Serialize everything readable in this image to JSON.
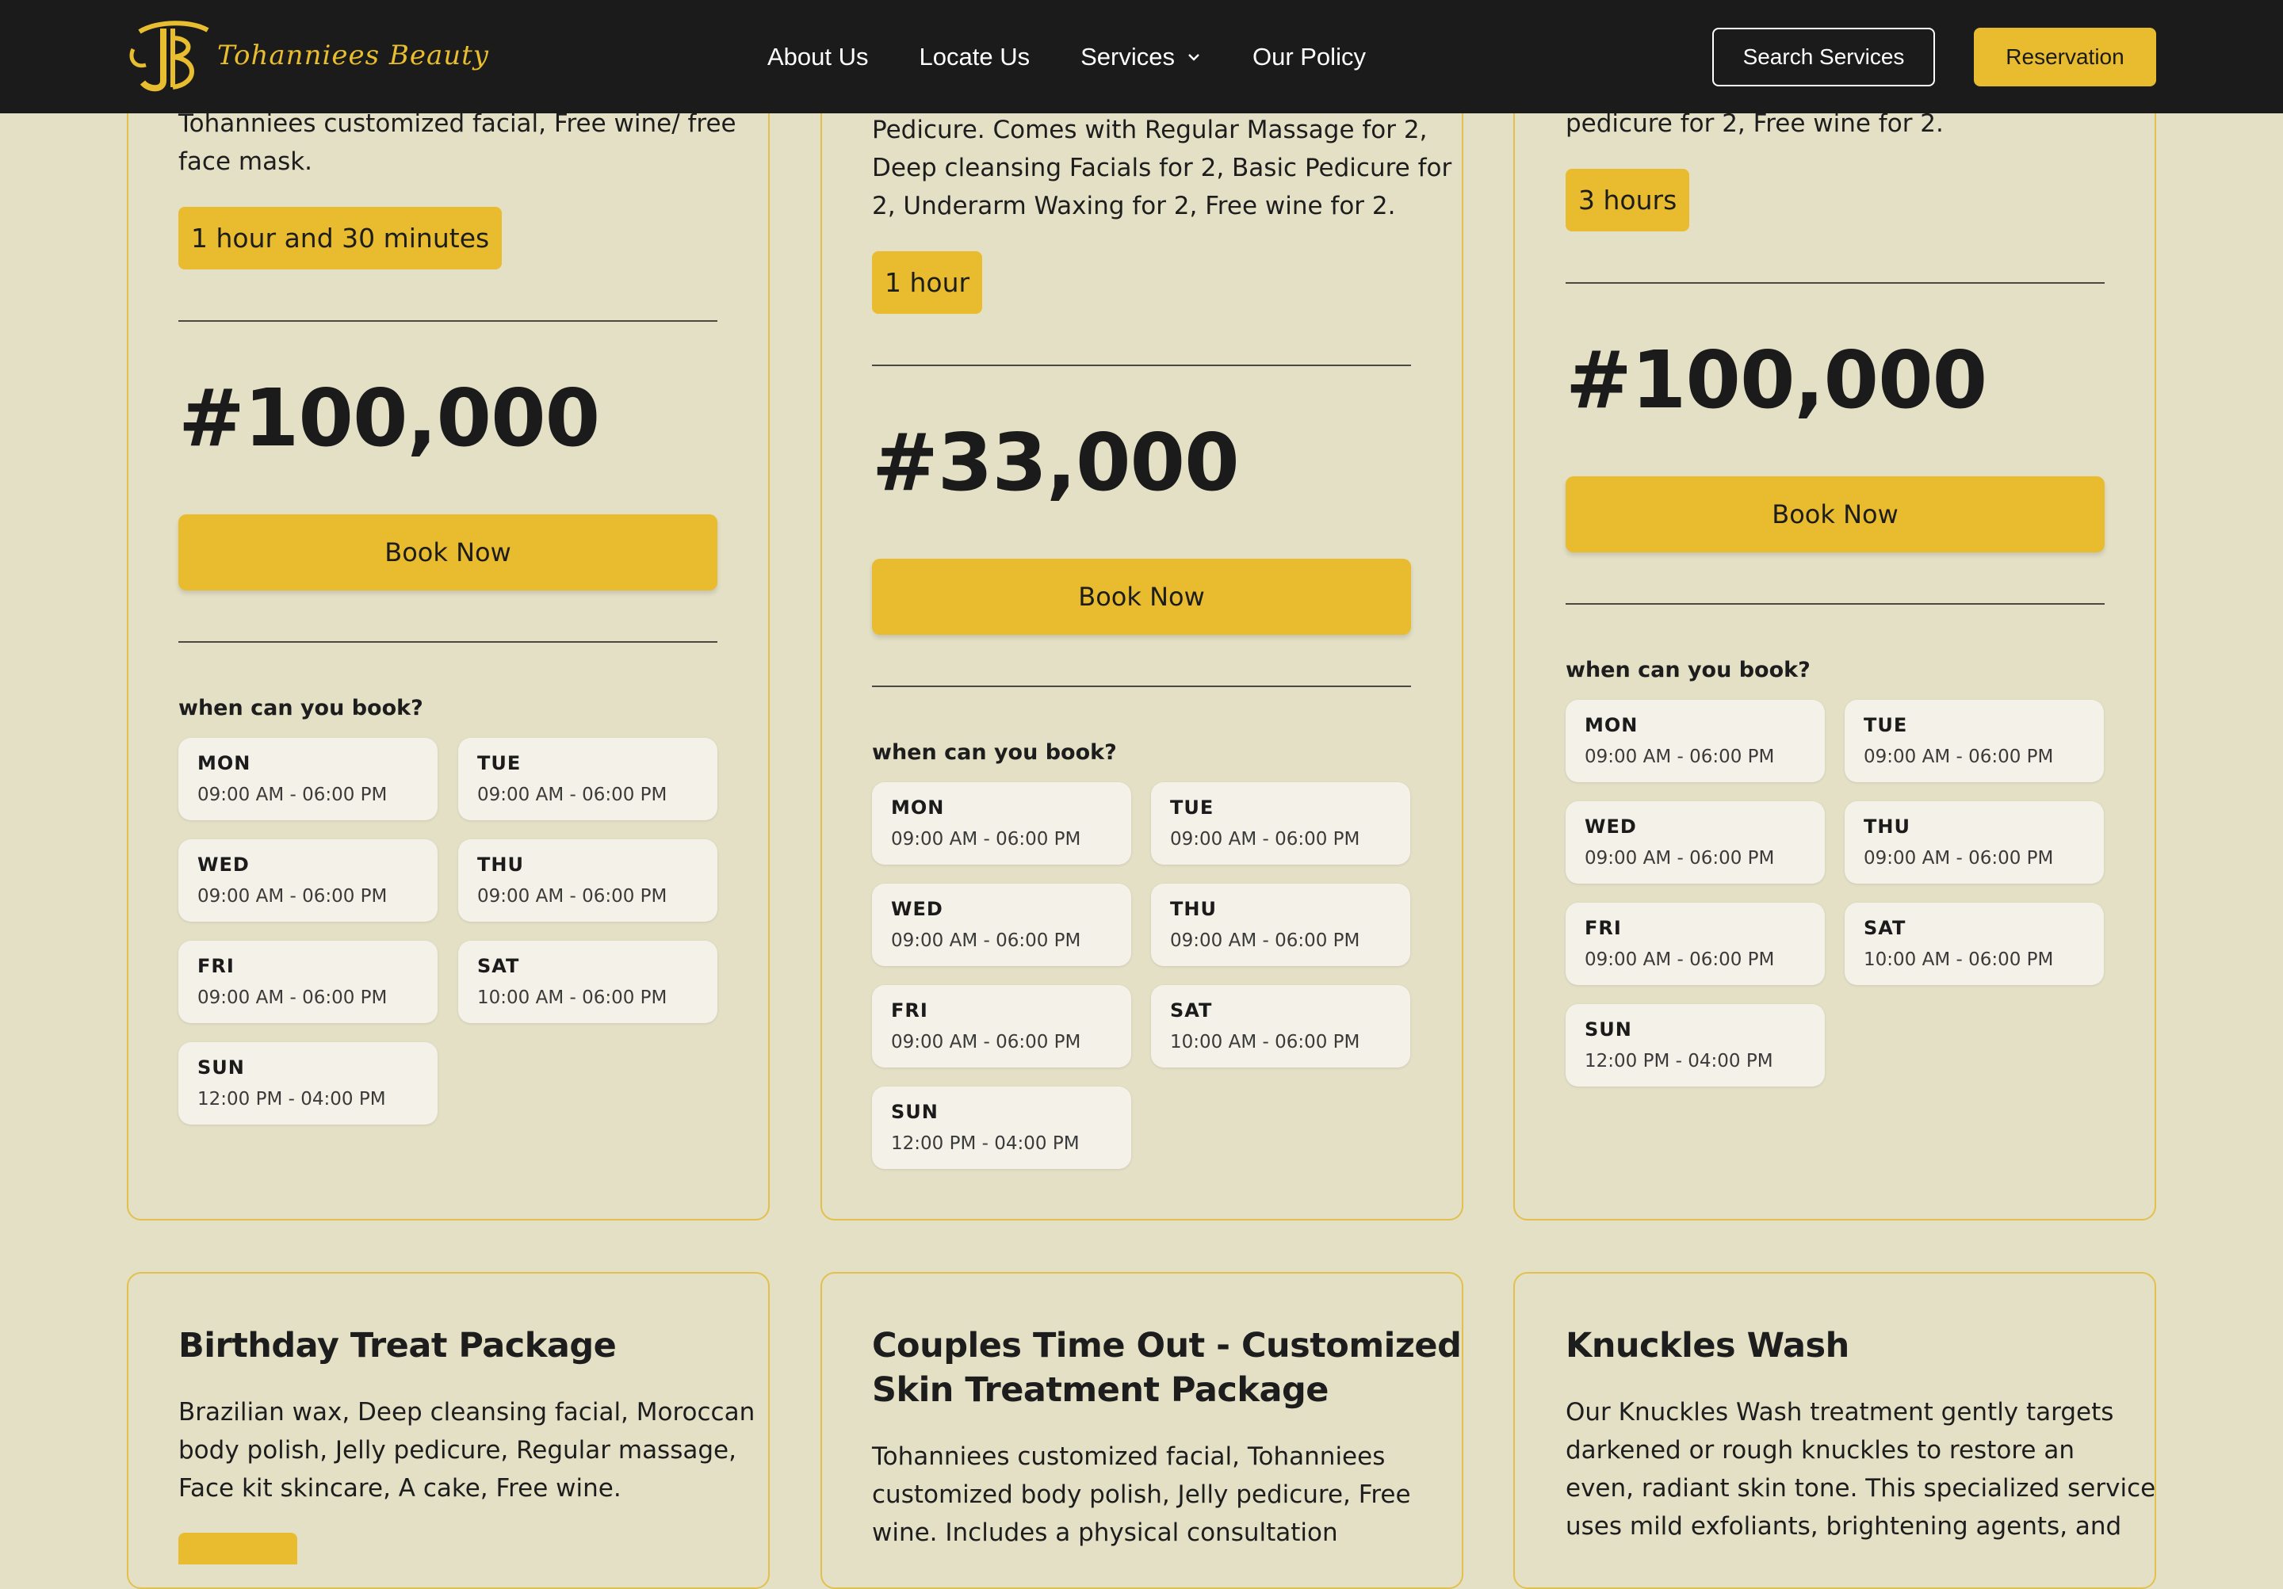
{
  "nav": {
    "brand": "Tohanniees Beauty",
    "links": [
      "About Us",
      "Locate Us",
      "Services",
      "Our Policy"
    ],
    "search_label": "Search Services",
    "reservation_label": "Reservation"
  },
  "cards_top": [
    {
      "desc": [
        "Tohanniees customized facial, Free wine/ free",
        "face mask."
      ],
      "duration": "1 hour and 30 minutes",
      "price": "#100,000",
      "book": "Book Now",
      "when": "when can you book?",
      "days": [
        {
          "d": "MON",
          "t": "09:00 AM - 06:00 PM"
        },
        {
          "d": "TUE",
          "t": "09:00 AM - 06:00 PM"
        },
        {
          "d": "WED",
          "t": "09:00 AM - 06:00 PM"
        },
        {
          "d": "THU",
          "t": "09:00 AM - 06:00 PM"
        },
        {
          "d": "FRI",
          "t": "09:00 AM - 06:00 PM"
        },
        {
          "d": "SAT",
          "t": "10:00 AM - 06:00 PM"
        },
        {
          "d": "SUN",
          "t": "12:00 PM - 04:00 PM"
        }
      ]
    },
    {
      "desc": [
        "Pedicure. Comes with Regular Massage for 2,",
        "Deep cleansing Facials for 2, Basic Pedicure for",
        "2, Underarm Waxing for 2, Free wine for 2."
      ],
      "duration": "1 hour",
      "price": "#33,000",
      "book": "Book Now",
      "when": "when can you book?",
      "days": [
        {
          "d": "MON",
          "t": "09:00 AM - 06:00 PM"
        },
        {
          "d": "TUE",
          "t": "09:00 AM - 06:00 PM"
        },
        {
          "d": "WED",
          "t": "09:00 AM - 06:00 PM"
        },
        {
          "d": "THU",
          "t": "09:00 AM - 06:00 PM"
        },
        {
          "d": "FRI",
          "t": "09:00 AM - 06:00 PM"
        },
        {
          "d": "SAT",
          "t": "10:00 AM - 06:00 PM"
        },
        {
          "d": "SUN",
          "t": "12:00 PM - 04:00 PM"
        }
      ]
    },
    {
      "desc": [
        "pedicure for 2, Free wine for 2."
      ],
      "duration": "3 hours",
      "price": "#100,000",
      "book": "Book Now",
      "when": "when can you book?",
      "days": [
        {
          "d": "MON",
          "t": "09:00 AM - 06:00 PM"
        },
        {
          "d": "TUE",
          "t": "09:00 AM - 06:00 PM"
        },
        {
          "d": "WED",
          "t": "09:00 AM - 06:00 PM"
        },
        {
          "d": "THU",
          "t": "09:00 AM - 06:00 PM"
        },
        {
          "d": "FRI",
          "t": "09:00 AM - 06:00 PM"
        },
        {
          "d": "SAT",
          "t": "10:00 AM - 06:00 PM"
        },
        {
          "d": "SUN",
          "t": "12:00 PM - 04:00 PM"
        }
      ]
    }
  ],
  "cards_bottom": [
    {
      "title": [
        "Birthday Treat Package"
      ],
      "desc": [
        "Brazilian wax, Deep cleansing facial, Moroccan",
        "body polish, Jelly pedicure, Regular massage,",
        "Face kit skincare, A cake, Free wine."
      ]
    },
    {
      "title": [
        "Couples Time Out - Customized",
        "Skin Treatment Package"
      ],
      "desc": [
        "Tohanniees customized facial, Tohanniees",
        "customized body polish, Jelly pedicure, Free",
        "wine. Includes a physical consultation"
      ]
    },
    {
      "title": [
        "Knuckles Wash"
      ],
      "desc": [
        "Our Knuckles Wash treatment gently targets",
        "darkened or rough knuckles to restore an",
        "even, radiant skin tone. This specialized service",
        "uses mild exfoliants, brightening agents, and"
      ]
    }
  ],
  "colors": {
    "accent": "#e9bc2f",
    "nav_bg": "#1b1b1b",
    "page_bg": "#e4e0c6",
    "card_border": "#e2c04b"
  },
  "icons": {
    "services_dropdown": "chevron-down-icon",
    "brand": "logo-monogram"
  }
}
